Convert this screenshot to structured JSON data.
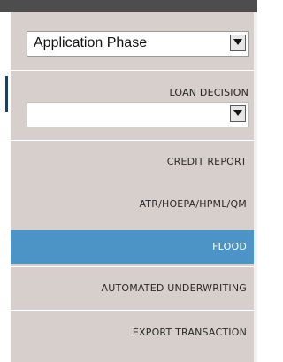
{
  "application_phase": {
    "selected": "Application Phase",
    "dropdown_icon": "triangle-down-icon"
  },
  "loan_decision": {
    "label": "LOAN DECISION",
    "selected": "",
    "dropdown_icon": "triangle-down-icon"
  },
  "nav": {
    "items": [
      {
        "label": "CREDIT REPORT",
        "active": false
      },
      {
        "label": "ATR/HOEPA/HPML/QM",
        "active": false
      },
      {
        "label": "FLOOD",
        "active": true
      },
      {
        "label": "AUTOMATED UNDERWRITING",
        "active": false
      },
      {
        "label": "EXPORT TRANSACTION",
        "active": false
      }
    ]
  },
  "colors": {
    "panel": "#d6cfcc",
    "active": "#4d94c6",
    "top_bar": "#4d4d4d"
  }
}
